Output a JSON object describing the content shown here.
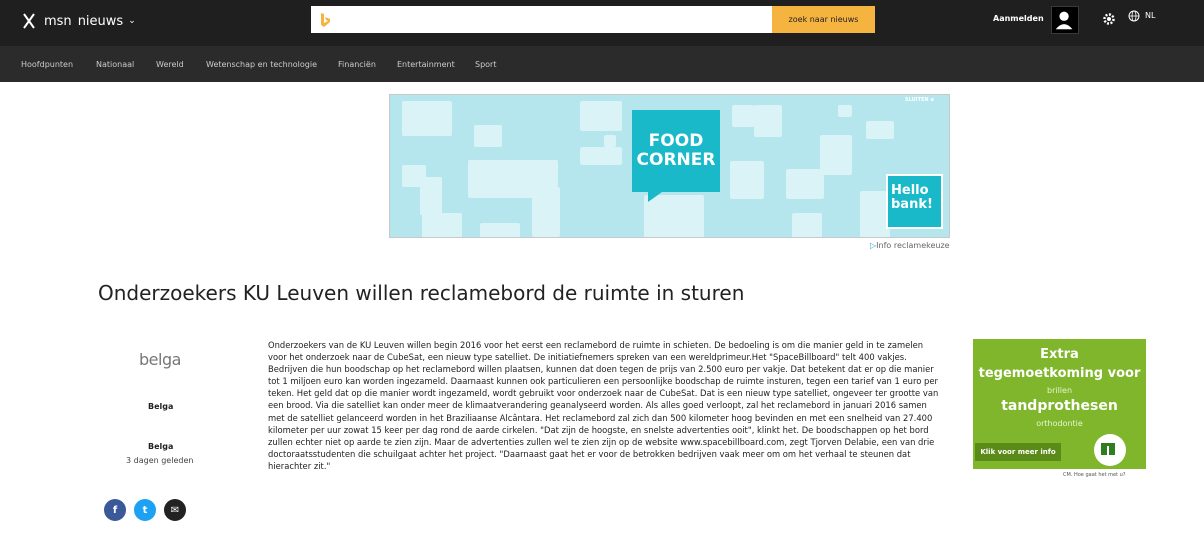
{
  "header": {
    "brand": "msn",
    "section": "nieuws",
    "search_placeholder": "",
    "search_button": "zoek naar nieuws",
    "signin": "Aanmelden",
    "language": "NL"
  },
  "nav": [
    "Hoofdpunten",
    "Nationaal",
    "Wereld",
    "Wetenschap en technologie",
    "Financiën",
    "Entertainment",
    "Sport"
  ],
  "ad_top": {
    "close_label": "SLUITEN ⊗",
    "food_line1": "FOOD",
    "food_line2": "CORNER",
    "hello_line1": "Hello",
    "hello_line2": "bank!",
    "info": "Info reclamekeuze"
  },
  "article": {
    "headline": "Onderzoekers KU Leuven willen reclamebord de ruimte in sturen",
    "logo_text": "belga",
    "source1": "Belga",
    "source2": "Belga",
    "time_ago": "3 dagen geleden",
    "body": "Onderzoekers van de KU Leuven willen begin 2016 voor het eerst een reclamebord de ruimte in schieten. De bedoeling is om die manier geld in te zamelen voor het onderzoek naar de CubeSat, een nieuw type satelliet. De initiatiefnemers spreken van een wereldprimeur.Het \"SpaceBillboard\" telt 400 vakjes. Bedrijven die hun boodschap op het reclamebord willen plaatsen, kunnen dat doen tegen de prijs van 2.500 euro per vakje. Dat betekent dat er op die manier tot 1 miljoen euro kan worden ingezameld. Daarnaast kunnen ook particulieren een persoonlijke boodschap de ruimte insturen, tegen een tarief van 1 euro per teken. Het geld dat op die manier wordt ingezameld, wordt gebruikt voor onderzoek naar de CubeSat. Dat is een nieuw type satelliet, ongeveer ter grootte van een brood. Via die satelliet kan onder meer de klimaatverandering geanalyseerd worden. Als alles goed verloopt, zal het reclamebord in januari 2016 samen met de satelliet gelanceerd worden in het Braziliaanse Alcântara. Het reclamebord zal zich dan 500 kilometer hoog bevinden en met een snelheid van 27.400 kilometer per uur zowat 15 keer per dag rond de aarde cirkelen. \"Dat zijn de hoogste, en snelste advertenties ooit\", klinkt het. De boodschappen op het bord zullen echter niet op aarde te zien zijn. Maar de advertenties zullen wel te zien zijn op de website www.spacebillboard.com, zegt Tjorven Delabie, een van drie doctoraatsstudenten die schuilgaat achter het project. \"Daarnaast gaat het er voor de betrokken bedrijven vaak meer om om het verhaal te steunen dat hierachter zit.\""
  },
  "share": {
    "facebook": "f",
    "twitter": "t",
    "email": "✉"
  },
  "ad_right": {
    "line1": "Extra",
    "line2": "tegemoetkoming voor",
    "line3": "brillen",
    "line4": "tandprothesen",
    "line5": "orthodontie",
    "button": "Klik voor meer info",
    "footer": "CM. Hoe gaat het met u?"
  },
  "colors": {
    "topbar": "#1f1f1f",
    "navbar": "#2b2b2b",
    "search_button": "#f5b33f",
    "ad_teal": "#19b9c9",
    "ad_green": "#7fb62b"
  }
}
